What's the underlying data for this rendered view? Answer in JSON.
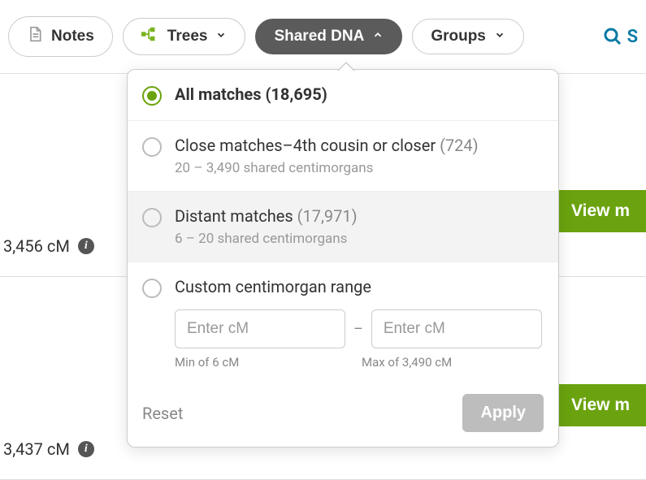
{
  "toolbar": {
    "notes": "Notes",
    "trees": "Trees",
    "shared_dna": "Shared DNA",
    "groups": "Groups",
    "search_char": "S"
  },
  "rows": [
    {
      "cm": "3,456 cM",
      "view": "View m"
    },
    {
      "cm": "3,437 cM",
      "view": "View m"
    }
  ],
  "dropdown": {
    "options": {
      "all": {
        "label": "All matches",
        "count": "(18,695)"
      },
      "close": {
        "label": "Close matches–4th cousin or closer",
        "count": "(724)",
        "sub": "20 – 3,490 shared centimorgans"
      },
      "distant": {
        "label": "Distant matches",
        "count": "(17,971)",
        "sub": "6 – 20 shared centimorgans"
      },
      "custom": {
        "label": "Custom centimorgan range"
      }
    },
    "range": {
      "min_placeholder": "Enter cM",
      "max_placeholder": "Enter cM",
      "min_hint": "Min of 6 cM",
      "max_hint": "Max of 3,490 cM"
    },
    "reset": "Reset",
    "apply": "Apply"
  }
}
